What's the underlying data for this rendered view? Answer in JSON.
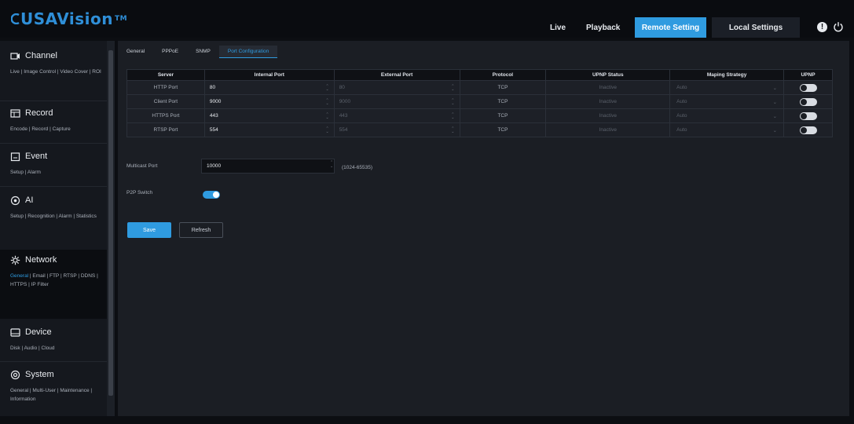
{
  "header": {
    "logo": "USAVision",
    "logo_mark": "TM",
    "nav": {
      "live": "Live",
      "playback": "Playback",
      "remote_setting": "Remote Setting",
      "local_settings": "Local Settings"
    }
  },
  "sidebar": {
    "groups": [
      {
        "title": "Channel",
        "icon": "channel-icon",
        "sub": "Live | Image Control | Video Cover | ROI"
      },
      {
        "title": "Record",
        "icon": "record-icon",
        "sub": "Encode | Record | Capture"
      },
      {
        "title": "Event",
        "icon": "event-icon",
        "sub": "Setup | Alarm"
      },
      {
        "title": "AI",
        "icon": "ai-icon",
        "sub": "Setup | Recognition | Alarm | Statistics"
      },
      {
        "title": "Network",
        "icon": "network-icon",
        "sub_active": "General",
        "sub": " | Email | FTP | RTSP | DDNS | HTTPS | IP Filter"
      },
      {
        "title": "Device",
        "icon": "device-icon",
        "sub": "Disk | Audio | Cloud"
      },
      {
        "title": "System",
        "icon": "system-icon",
        "sub": "General | Multi-User | Maintenance | Information"
      }
    ]
  },
  "tabs": [
    "General",
    "PPPoE",
    "SNMP",
    "Port Configuration"
  ],
  "active_tab": "Port Configuration",
  "table": {
    "headers": [
      "Server",
      "Internal Port",
      "External Port",
      "Protocol",
      "UPNP Status",
      "Maping Strategy",
      "UPNP"
    ],
    "rows": [
      {
        "server": "HTTP Port",
        "internal": "80",
        "external": "80",
        "protocol": "TCP",
        "status": "Inactive",
        "strategy": "Auto",
        "upnp": "off"
      },
      {
        "server": "Client Port",
        "internal": "9000",
        "external": "9000",
        "protocol": "TCP",
        "status": "Inactive",
        "strategy": "Auto",
        "upnp": "off"
      },
      {
        "server": "HTTPS Port",
        "internal": "443",
        "external": "443",
        "protocol": "TCP",
        "status": "Inactive",
        "strategy": "Auto",
        "upnp": "off"
      },
      {
        "server": "RTSP Port",
        "internal": "554",
        "external": "554",
        "protocol": "TCP",
        "status": "Inactive",
        "strategy": "Auto",
        "upnp": "off"
      }
    ]
  },
  "multicast": {
    "label": "Multicast Port",
    "value": "10000",
    "range": "(1024-65535)"
  },
  "p2p": {
    "label": "P2P Switch",
    "state": "on"
  },
  "buttons": {
    "save": "Save",
    "refresh": "Refresh"
  },
  "colors": {
    "accent": "#2f9be0",
    "background": "#1b1e24"
  }
}
